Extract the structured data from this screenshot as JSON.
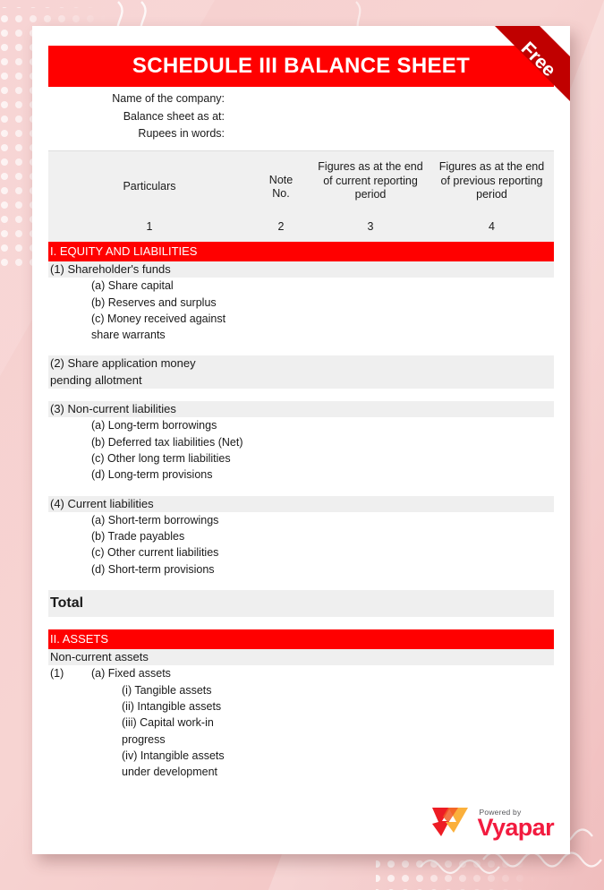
{
  "ribbon": {
    "label": "Free",
    "color": "#C00000"
  },
  "document": {
    "title": "SCHEDULE III BALANCE SHEET",
    "title_bg": "#FF0000",
    "meta": [
      "Name of the company:",
      "Balance sheet as at:",
      "Rupees in words:"
    ]
  },
  "table": {
    "headers": [
      "Particulars",
      "Note\nNo.",
      "Figures as at the end of current reporting period",
      "Figures as at the end of previous reporting period"
    ],
    "header_numbers": [
      "1",
      "2",
      "3",
      "4"
    ],
    "rows": [
      {
        "type": "section",
        "label": "I. EQUITY AND LIABILITIES"
      },
      {
        "type": "group",
        "label": "(1) Shareholder's funds"
      },
      {
        "type": "item",
        "indent": 2,
        "label": "(a) Share capital"
      },
      {
        "type": "item",
        "indent": 2,
        "label": "(b) Reserves and surplus"
      },
      {
        "type": "item",
        "indent": 2,
        "label": "(c) Money received against\n     share warrants"
      },
      {
        "type": "gap",
        "label": ""
      },
      {
        "type": "group",
        "label": "(2) Share application money\n     pending allotment"
      },
      {
        "type": "gap",
        "label": ""
      },
      {
        "type": "group",
        "label": "(3) Non-current liabilities"
      },
      {
        "type": "item",
        "indent": 2,
        "label": "(a) Long-term borrowings"
      },
      {
        "type": "item",
        "indent": 2,
        "label": "(b) Deferred tax liabilities (Net)"
      },
      {
        "type": "item",
        "indent": 2,
        "label": "(c) Other long term liabilities"
      },
      {
        "type": "item",
        "indent": 2,
        "label": "(d) Long-term provisions"
      },
      {
        "type": "gap",
        "label": ""
      },
      {
        "type": "group",
        "label": "(4) Current liabilities"
      },
      {
        "type": "item",
        "indent": 2,
        "label": "(a) Short-term borrowings"
      },
      {
        "type": "item",
        "indent": 2,
        "label": "(b) Trade payables"
      },
      {
        "type": "item",
        "indent": 2,
        "label": "(c) Other current liabilities"
      },
      {
        "type": "item",
        "indent": 2,
        "label": "(d) Short-term provisions"
      },
      {
        "type": "gap",
        "label": ""
      },
      {
        "type": "total",
        "label": "Total"
      },
      {
        "type": "gap",
        "label": ""
      },
      {
        "type": "section",
        "label": "II. ASSETS"
      },
      {
        "type": "group",
        "label": "Non-current assets"
      },
      {
        "type": "marker",
        "marker": "(1)",
        "label": "(a) Fixed assets"
      },
      {
        "type": "item",
        "indent": 3,
        "label": "(i) Tangible assets"
      },
      {
        "type": "item",
        "indent": 3,
        "label": "(ii) Intangible assets"
      },
      {
        "type": "item",
        "indent": 3,
        "label": "(iii) Capital work-in\n       progress"
      },
      {
        "type": "item",
        "indent": 3,
        "label": "(iv) Intangible assets\n       under development"
      }
    ]
  },
  "footer": {
    "powered_by": "Powered by",
    "brand": "Vyapar",
    "brand_color": "#F21B3F"
  }
}
